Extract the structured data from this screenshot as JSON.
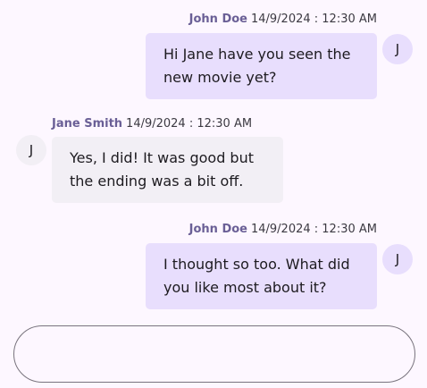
{
  "colors": {
    "background": "#fdf7ff",
    "outgoing_bubble": "#e8defd",
    "incoming_bubble": "#f2eff5",
    "outgoing_avatar": "#e8defd",
    "incoming_avatar": "#f2eff5",
    "sender_name": "#6a5f96"
  },
  "messages": [
    {
      "direction": "outgoing",
      "sender": "John Doe",
      "timestamp": "14/9/2024 : 12:30 AM",
      "text": "Hi Jane have you seen the new movie yet?",
      "avatar_initial": "J"
    },
    {
      "direction": "incoming",
      "sender": "Jane Smith",
      "timestamp": "14/9/2024 : 12:30 AM",
      "text": "Yes, I did! It was good but the ending was a bit off.",
      "avatar_initial": "J"
    },
    {
      "direction": "outgoing",
      "sender": "John Doe",
      "timestamp": "14/9/2024 : 12:30 AM",
      "text": "I thought so too. What did you like most about it?",
      "avatar_initial": "J"
    }
  ],
  "composer": {
    "value": "",
    "placeholder": ""
  }
}
